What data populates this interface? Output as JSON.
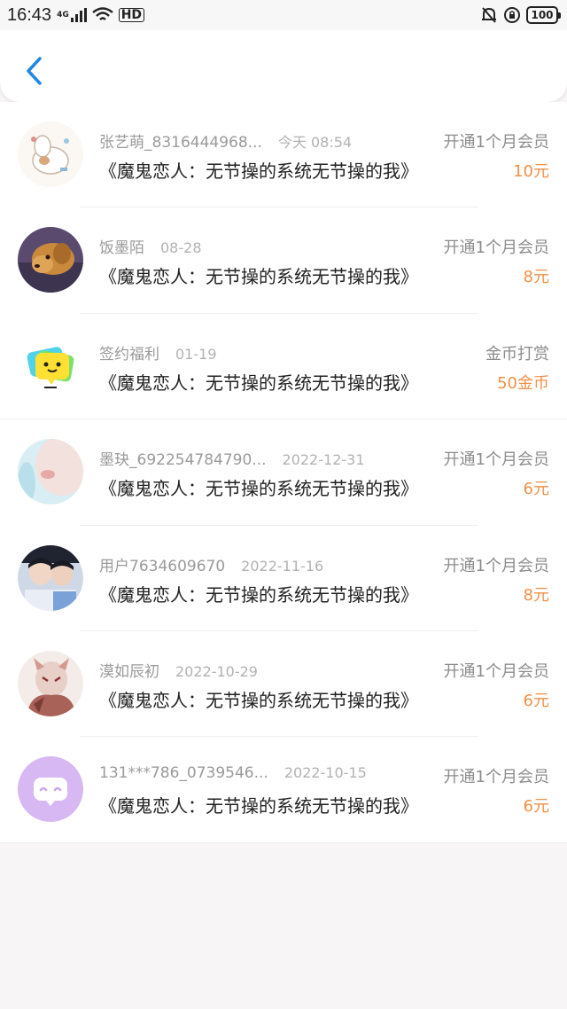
{
  "status_bar": {
    "time": "16:43",
    "network": "4G",
    "hd": "HD",
    "battery": "100",
    "icons": [
      "signal-icon",
      "wifi-icon",
      "bell-off-icon",
      "lock-rotation-icon"
    ]
  },
  "header": {
    "back_icon": "chevron-left-icon",
    "accent_color": "#1e88e5"
  },
  "colors": {
    "amount": "#f39046",
    "meta": "#9a9a9a",
    "title": "#222222"
  },
  "records": [
    {
      "user": "张艺萌_8316444968...",
      "date": "今天 08:54",
      "book": "《魔鬼恋人：无节操的系统无节操的我》",
      "action": "开通1个月会员",
      "amount": "10元",
      "avatar": "cartoon-dog-avatar"
    },
    {
      "user": "饭墨陌",
      "date": "08-28",
      "book": "《魔鬼恋人：无节操的系统无节操的我》",
      "action": "开通1个月会员",
      "amount": "8元",
      "avatar": "golden-dog-avatar"
    },
    {
      "user": "签约福利",
      "date": "01-19",
      "book": "《魔鬼恋人：无节操的系统无节操的我》",
      "action": "金币打赏",
      "amount": "50金币",
      "avatar": "chat-bubble-avatar"
    },
    {
      "user": "墨玦_692254784790...",
      "date": "2022-12-31",
      "book": "《魔鬼恋人：无节操的系统无节操的我》",
      "action": "开通1个月会员",
      "amount": "6元",
      "avatar": "face-closeup-avatar"
    },
    {
      "user": "用户7634609670",
      "date": "2022-11-16",
      "book": "《魔鬼恋人：无节操的系统无节操的我》",
      "action": "开通1个月会员",
      "amount": "8元",
      "avatar": "two-people-avatar"
    },
    {
      "user": "漠如辰初",
      "date": "2022-10-29",
      "book": "《魔鬼恋人：无节操的系统无节操的我》",
      "action": "开通1个月会员",
      "amount": "6元",
      "avatar": "masked-figure-avatar"
    },
    {
      "user": "131***786_0739546...",
      "date": "2022-10-15",
      "book": "《魔鬼恋人：无节操的系统无节操的我》",
      "action": "开通1个月会员",
      "amount": "6元",
      "avatar": "purple-chat-avatar"
    }
  ]
}
